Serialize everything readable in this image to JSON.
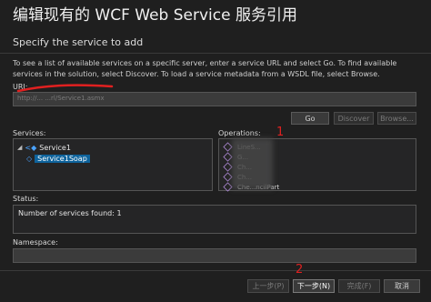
{
  "dialog": {
    "title": "编辑现有的 WCF Web Service 服务引用",
    "subtitle": "Specify the service to add"
  },
  "description": "To see a list of available services on a specific server, enter a service URL and select Go. To find available services in the solution, select Discover.  To load a service metadata from a WSDL file, select Browse.",
  "uri": {
    "label": "URI:",
    "value": "http://...                                   ...rl/Service1.asmx"
  },
  "buttons": {
    "go": "Go",
    "discover": "Discover",
    "browse": "Browse...",
    "prev": "上一步(P)",
    "next": "下一步(N)",
    "finish": "完成(F)",
    "cancel": "取消"
  },
  "services": {
    "label": "Services:",
    "root": "Service1",
    "child": "Service1Soap"
  },
  "operations": {
    "label": "Operations:",
    "items": [
      "LineS...",
      "G...",
      "Ch...",
      "Ch...",
      "Che...ncilPart"
    ]
  },
  "status": {
    "label": "Status:",
    "text": "Number of services found: 1"
  },
  "namespace": {
    "label": "Namespace:",
    "value": ""
  },
  "annotations": {
    "one": "1",
    "two": "2"
  },
  "colors": {
    "annotation_red": "#e02020",
    "selection": "#0e639c",
    "background": "#1f1f1f"
  }
}
